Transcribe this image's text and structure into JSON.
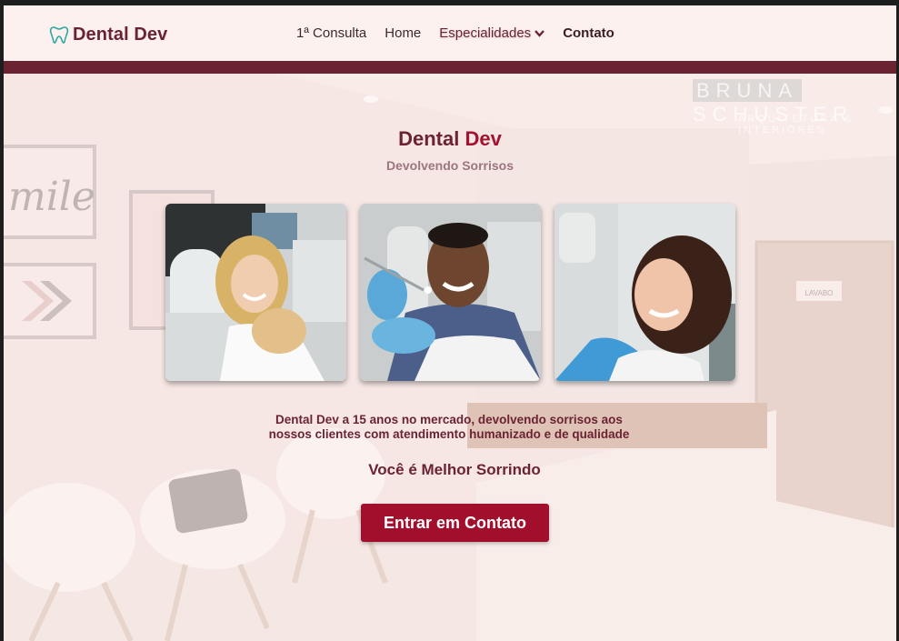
{
  "nav": {
    "brand": "Dental Dev",
    "items": [
      {
        "label": "1ª Consulta"
      },
      {
        "label": "Home"
      },
      {
        "label": "Especialidades"
      },
      {
        "label": "Contato"
      }
    ],
    "dropdown_icon": "chevron-down-icon",
    "logo_icon": "tooth-icon"
  },
  "hero": {
    "title_main": "Dental",
    "title_accent": "Dev",
    "subtitle": "Devolvendo Sorrisos",
    "photos": [
      {
        "name": "photo-smiling-woman-blonde"
      },
      {
        "name": "photo-smiling-man-dentist"
      },
      {
        "name": "photo-smiling-woman-brunette"
      }
    ],
    "description_line1": "Dental Dev a 15 anos no mercado, devolvendo sorrisos aos",
    "description_line2": "nossos clientes com atendimento humanizado e de qualidade",
    "slogan": "Você é Melhor Sorrindo",
    "cta_label": "Entrar em Contato"
  },
  "background": {
    "wall_text": "mile",
    "watermark": "BRUNA SCHUSTER",
    "watermark_box": "BRUNA",
    "watermark_rest": " SCHUSTER",
    "watermark_sub": "ARQUITETURA & INTERIORES",
    "door_sign": "LAVABO"
  },
  "colors": {
    "brand": "#6b2332",
    "accent": "#a3122e",
    "cta": "#a10f2d"
  }
}
